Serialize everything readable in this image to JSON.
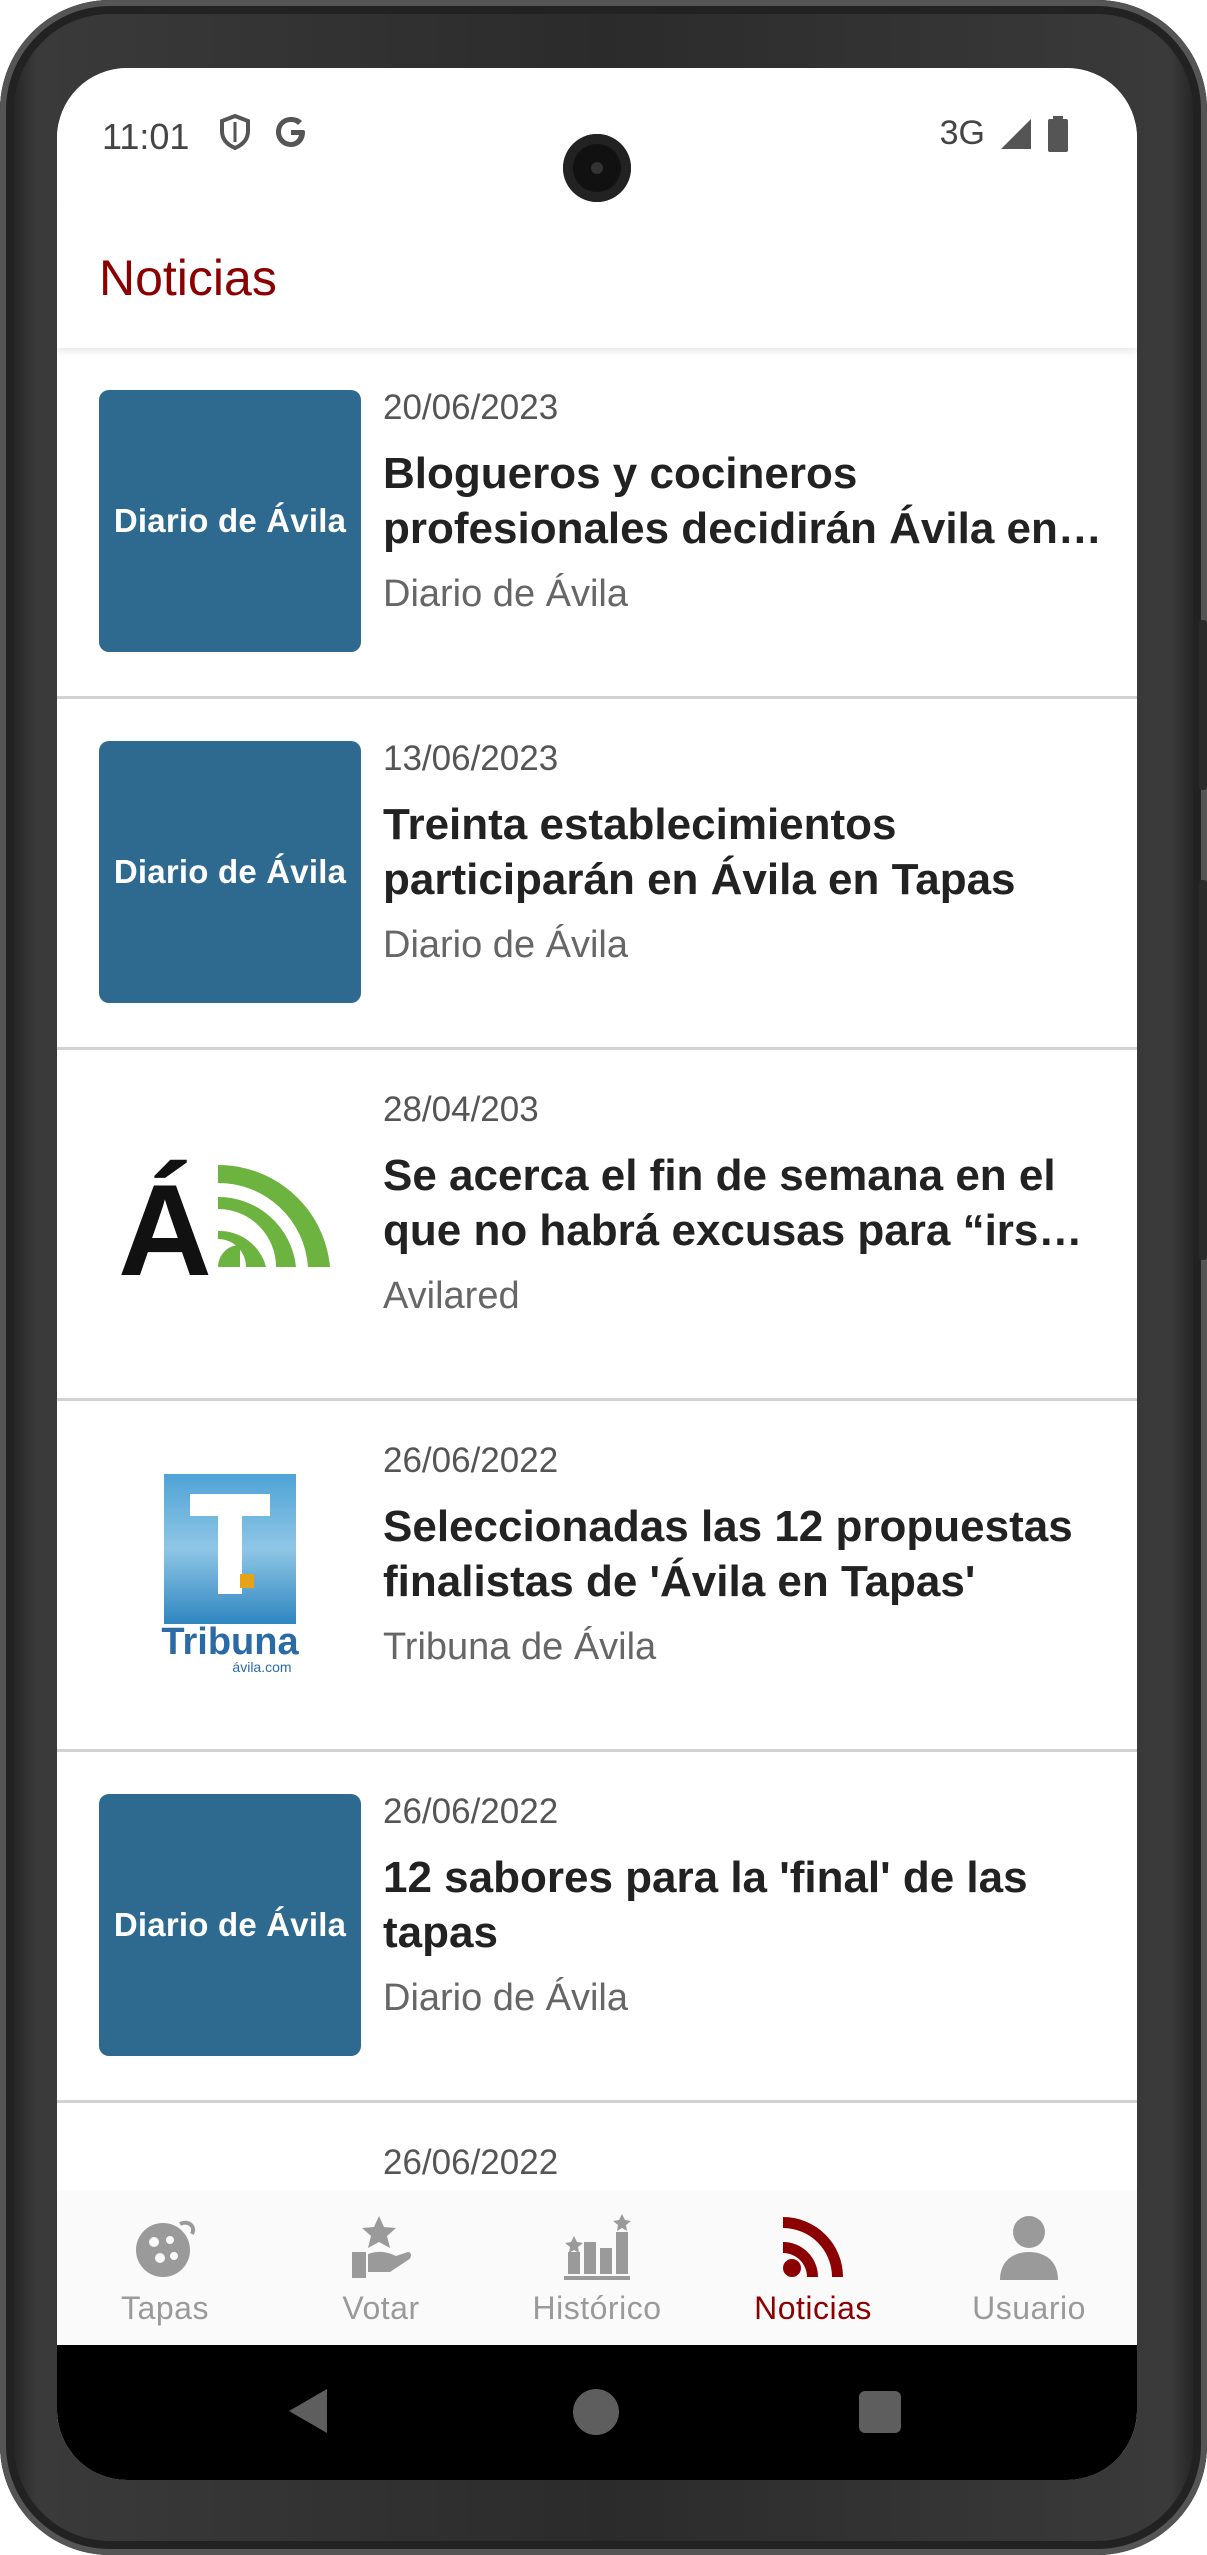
{
  "status_bar": {
    "time": "11:01",
    "network": "3G",
    "left_icons": [
      "shield-icon",
      "google-icon"
    ],
    "right_icons": [
      "signal-icon",
      "battery-icon"
    ]
  },
  "app_bar": {
    "title": "Noticias",
    "title_color": "#8b0000"
  },
  "news": [
    {
      "date": "20/06/2023",
      "title": "Blogueros y cocineros profesionales decidirán Ávila en Tapas",
      "source": "Diario de Ávila",
      "thumb_type": "diario",
      "thumb_text": "Diario de Ávila"
    },
    {
      "date": "13/06/2023",
      "title": "Treinta establecimientos participarán en Ávila en Tapas",
      "source": "Diario de Ávila",
      "thumb_type": "diario",
      "thumb_text": "Diario de Ávila"
    },
    {
      "date": "28/04/203",
      "title": "Se acerca el fin de semana en el que no habrá excusas para “irse de tapas”",
      "source": "Avilared",
      "thumb_type": "avilared",
      "thumb_text": "Á"
    },
    {
      "date": "26/06/2022",
      "title": "Seleccionadas las 12 propuestas finalistas de 'Ávila en Tapas'",
      "source": "Tribuna de Ávila",
      "thumb_type": "tribuna",
      "thumb_text": "Tribuna",
      "thumb_subtext": "ávila.com"
    },
    {
      "date": "26/06/2022",
      "title": "12 sabores para la 'final' de las tapas",
      "source": "Diario de Ávila",
      "thumb_type": "diario",
      "thumb_text": "Diario de Ávila"
    },
    {
      "date": "26/06/2022",
      "title": "",
      "source": "",
      "thumb_type": "none",
      "thumb_text": ""
    }
  ],
  "bottom_nav": [
    {
      "label": "Tapas",
      "icon": "tapas-plate-icon",
      "active": false
    },
    {
      "label": "Votar",
      "icon": "vote-hand-star-icon",
      "active": false
    },
    {
      "label": "Histórico",
      "icon": "history-bars-stars-icon",
      "active": false
    },
    {
      "label": "Noticias",
      "icon": "rss-feed-icon",
      "active": true
    },
    {
      "label": "Usuario",
      "icon": "user-icon",
      "active": false
    }
  ],
  "colors": {
    "accent": "#8b0000",
    "inactive": "#9a9a9a",
    "diario_bg": "#2e6a8f",
    "avilared_green": "#6db33f"
  }
}
